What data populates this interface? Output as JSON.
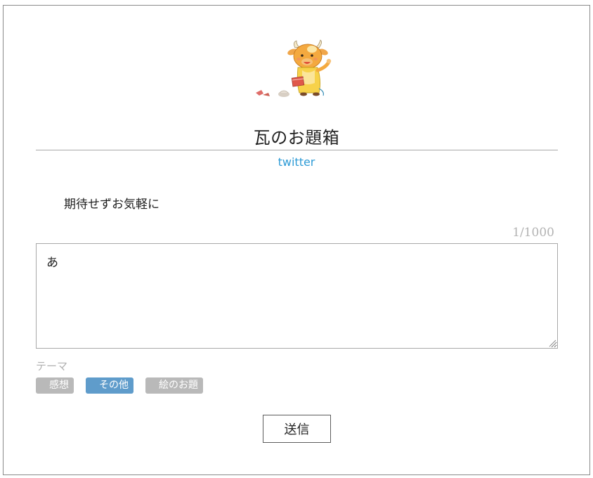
{
  "header": {
    "title": "瓦のお題箱",
    "twitter_link": "twitter"
  },
  "mascot": {
    "icon": "cow-mascot-illustration"
  },
  "description": "期待せずお気軽に",
  "message": {
    "char_count": "1/1000",
    "value": "あ"
  },
  "theme": {
    "label": "テーマ",
    "options": [
      {
        "label": "感想",
        "selected": false
      },
      {
        "label": "その他",
        "selected": true
      },
      {
        "label": "絵のお題",
        "selected": false
      }
    ]
  },
  "submit": {
    "label": "送信"
  },
  "colors": {
    "link": "#2e9bd6",
    "tag_active": "#5f9ccb",
    "tag_inactive": "#b9b9b9"
  }
}
